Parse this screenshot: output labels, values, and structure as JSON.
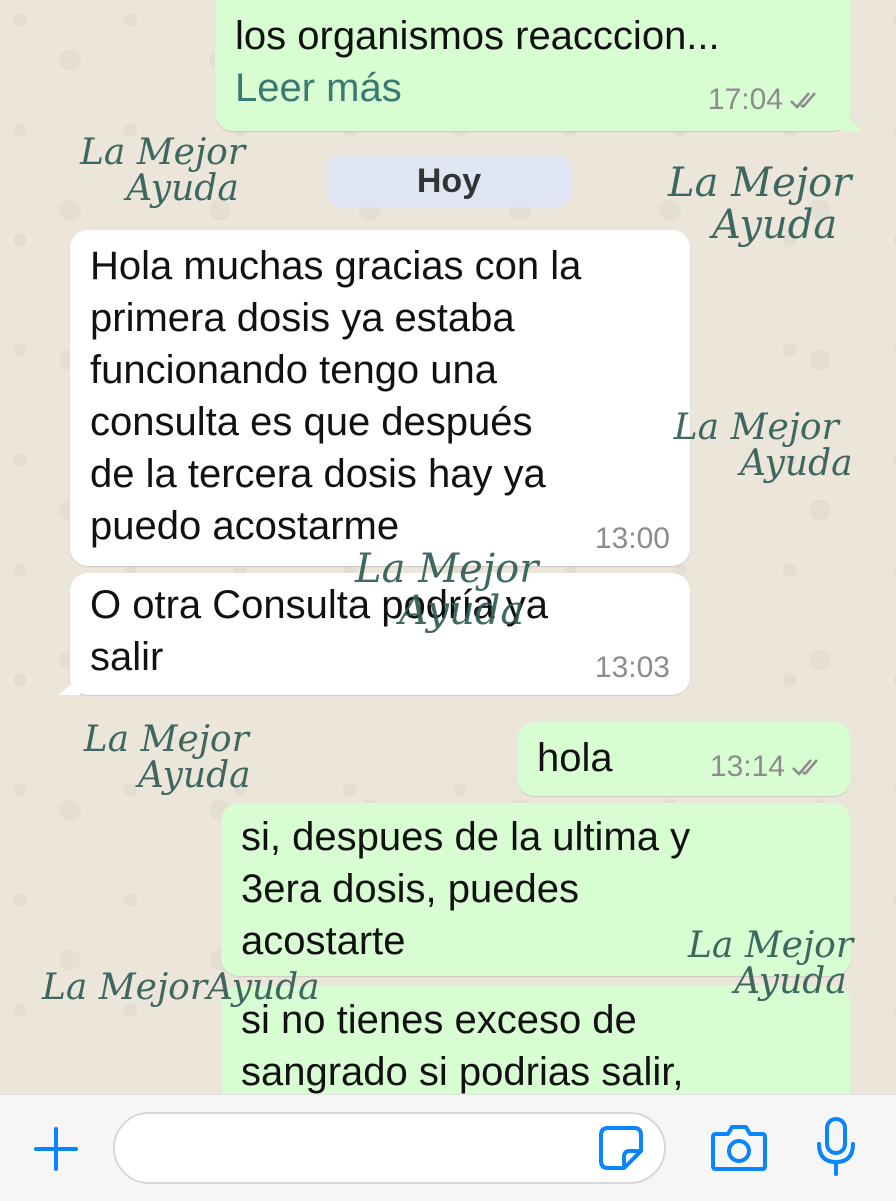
{
  "messages": [
    {
      "id": "m0",
      "direction": "out",
      "text": "los organismos reacccion...",
      "read_more": "Leer más",
      "time": "17:04",
      "status": "read"
    },
    {
      "id": "m1",
      "direction": "in",
      "text": "Hola muchas gracias con la\nprimera dosis ya estaba\nfuncionando tengo una\nconsulta es que después\nde la tercera dosis hay ya\npuedo acostarme",
      "time": "13:00"
    },
    {
      "id": "m2",
      "direction": "in",
      "text": "O otra Consulta podría ya\nsalir",
      "time": "13:03"
    },
    {
      "id": "m3",
      "direction": "out",
      "text": "hola",
      "time": "13:14",
      "status": "read"
    },
    {
      "id": "m4",
      "direction": "out",
      "text": "si, despues de la ultima y\n3era dosis, puedes\nacostarte"
    },
    {
      "id": "m5",
      "direction": "out",
      "text": "si no tienes exceso de\nsangrado si podrias salir,"
    }
  ],
  "date_separator": "Hoy",
  "watermark": {
    "line1": "La Mejor",
    "line2": "Ayuda",
    "inline": "La MejorAyuda"
  },
  "composer": {
    "input_value": "",
    "icons": [
      "plus-icon",
      "sticker-icon",
      "camera-icon",
      "microphone-icon"
    ]
  },
  "colors": {
    "outgoing_bubble": "#d9fdd3",
    "incoming_bubble": "#ffffff",
    "accent": "#0a84ff",
    "read_tick": "#8c8c8c",
    "date_pill": "#dfe5f2"
  }
}
